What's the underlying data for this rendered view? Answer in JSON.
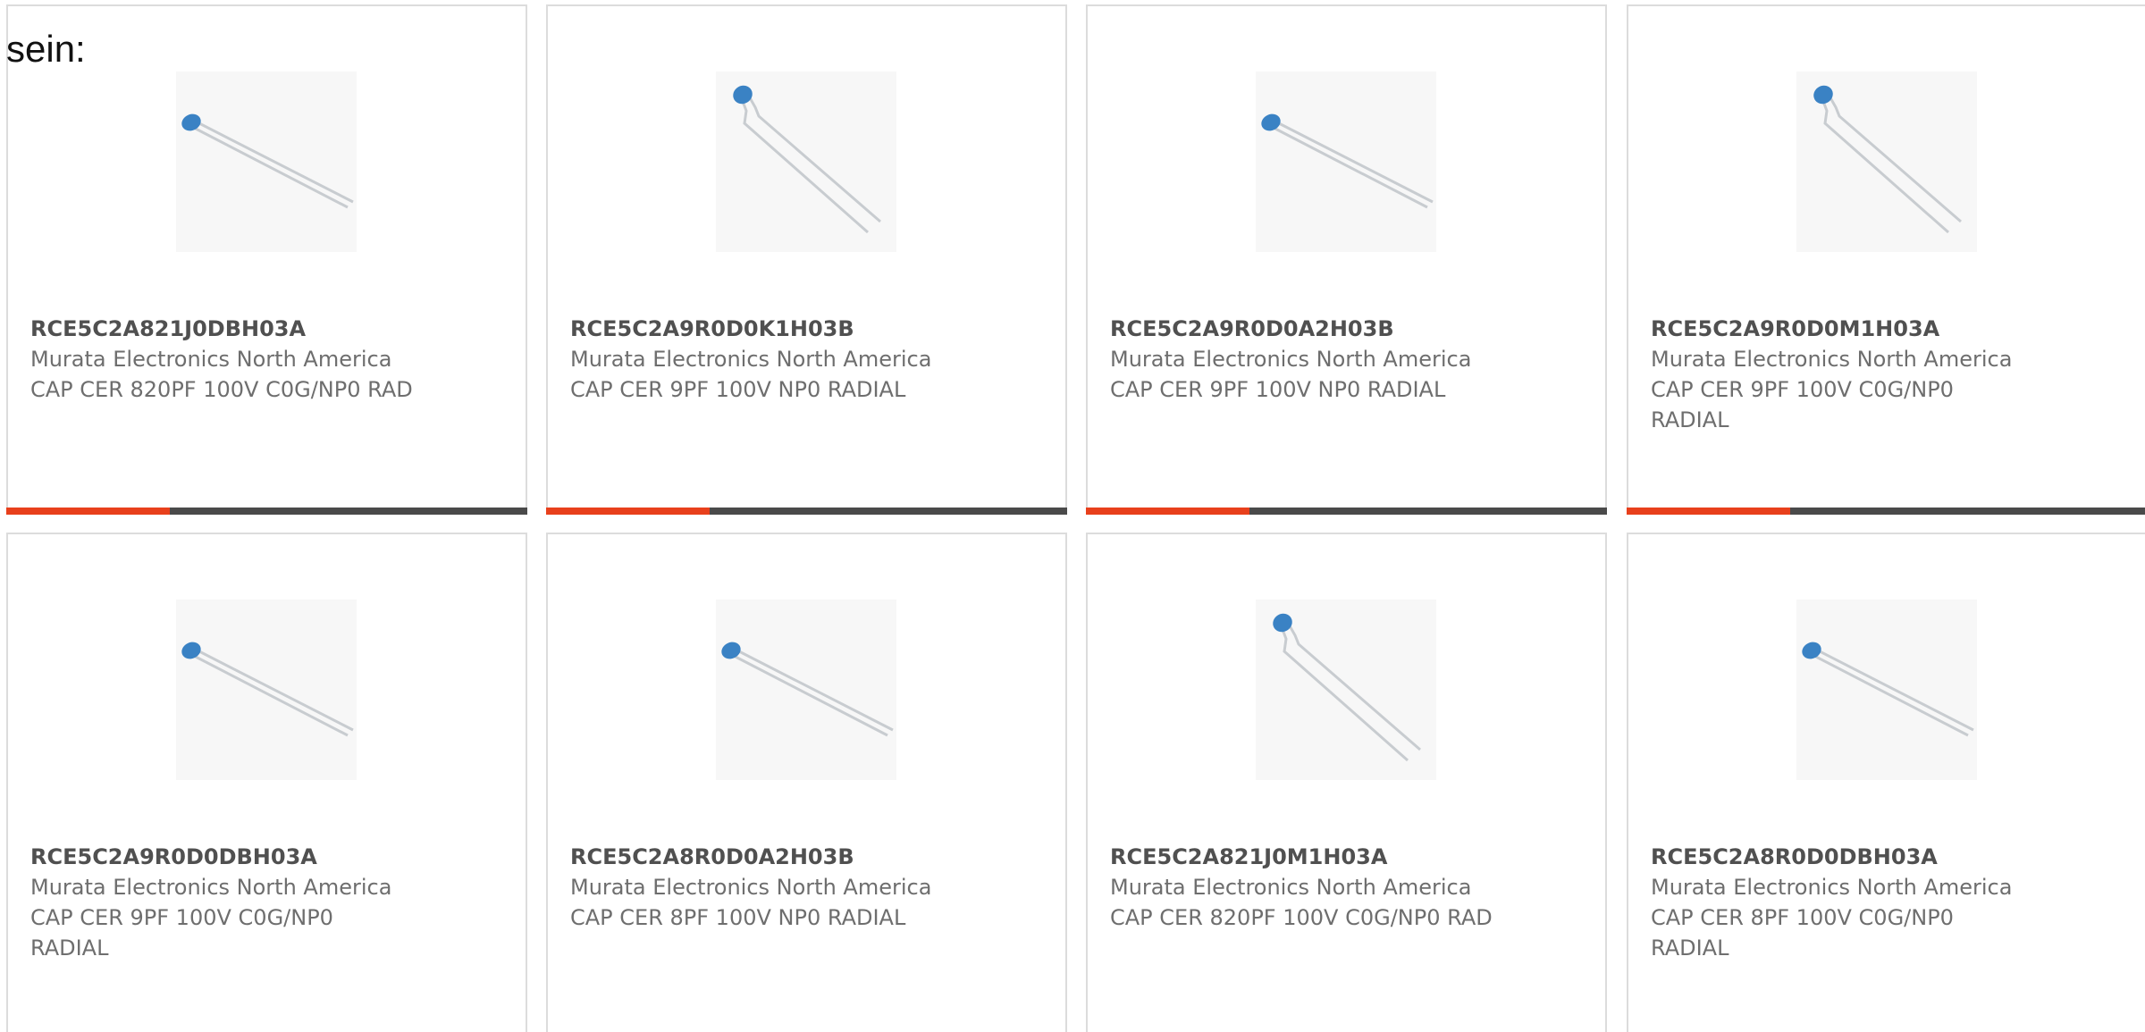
{
  "intro_text": "sein:",
  "accent_color": "#e8401c",
  "bar_color": "#4a4a4a",
  "products": [
    {
      "part": "RCE5C2A821J0DBH03A",
      "maker": "Murata Electronics North America",
      "desc": "CAP CER 820PF 100V C0G/NP0 RAD",
      "image": "capacitor-diagonal"
    },
    {
      "part": "RCE5C2A9R0D0K1H03B",
      "maker": "Murata Electronics North America",
      "desc": "CAP CER 9PF 100V NP0 RADIAL",
      "image": "capacitor-steep"
    },
    {
      "part": "RCE5C2A9R0D0A2H03B",
      "maker": "Murata Electronics North America",
      "desc": "CAP CER 9PF 100V NP0 RADIAL",
      "image": "capacitor-diagonal"
    },
    {
      "part": "RCE5C2A9R0D0M1H03A",
      "maker": "Murata Electronics North America",
      "desc": "CAP CER 9PF 100V C0G/NP0 RADIAL",
      "image": "capacitor-steep"
    },
    {
      "part": "RCE5C2A9R0D0DBH03A",
      "maker": "Murata Electronics North America",
      "desc": "CAP CER 9PF 100V C0G/NP0 RADIAL",
      "image": "capacitor-diagonal"
    },
    {
      "part": "RCE5C2A8R0D0A2H03B",
      "maker": "Murata Electronics North America",
      "desc": "CAP CER 8PF 100V NP0 RADIAL",
      "image": "capacitor-diagonal"
    },
    {
      "part": "RCE5C2A821J0M1H03A",
      "maker": "Murata Electronics North America",
      "desc": "CAP CER 820PF 100V C0G/NP0 RAD",
      "image": "capacitor-steep"
    },
    {
      "part": "RCE5C2A8R0D0DBH03A",
      "maker": "Murata Electronics North America",
      "desc": "CAP CER 8PF 100V C0G/NP0 RADIAL",
      "image": "capacitor-diagonal"
    }
  ]
}
